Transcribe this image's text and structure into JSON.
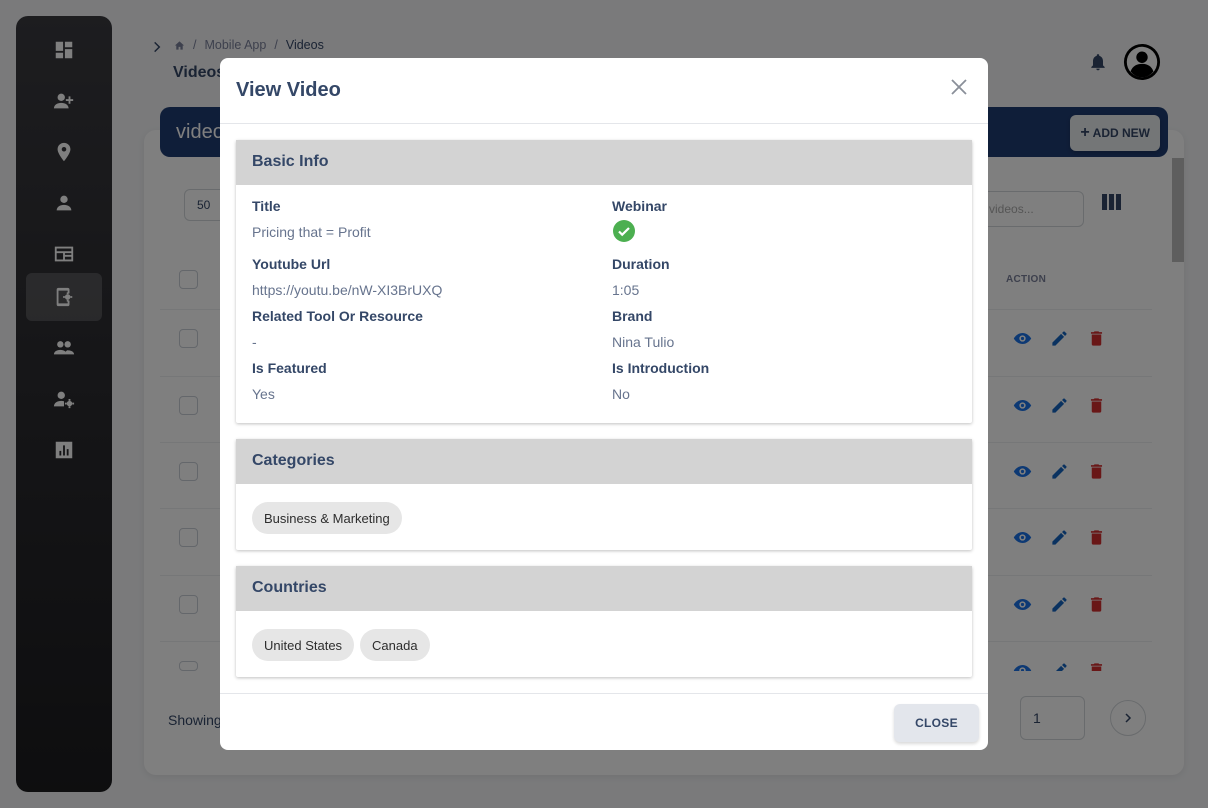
{
  "breadcrumb": {
    "parent": "Mobile App",
    "current": "Videos",
    "separator": "/"
  },
  "page": {
    "title": "Videos",
    "card_title": "videos",
    "add_new_label": "ADD NEW"
  },
  "table": {
    "per_page": "50",
    "search_placeholder": "videos...",
    "action_header": "ACTION",
    "showing_label": "Showing",
    "page_number": "1"
  },
  "sidebar": {
    "items": [
      {
        "icon": "dashboard-icon"
      },
      {
        "icon": "add-user-icon"
      },
      {
        "icon": "location-pin-icon"
      },
      {
        "icon": "person-icon"
      },
      {
        "icon": "news-icon"
      },
      {
        "icon": "mobile-settings-icon",
        "active": true
      },
      {
        "icon": "group-icon"
      },
      {
        "icon": "user-settings-icon"
      },
      {
        "icon": "analytics-icon"
      }
    ]
  },
  "modal": {
    "title": "View Video",
    "close_label": "CLOSE",
    "basic_info": {
      "heading": "Basic Info",
      "title_label": "Title",
      "title_value": "Pricing that = Profit",
      "webinar_label": "Webinar",
      "webinar_value": true,
      "youtube_label": "Youtube Url",
      "youtube_value": "https://youtu.be/nW-XI3BrUXQ",
      "duration_label": "Duration",
      "duration_value": "1:05",
      "related_label": "Related Tool Or Resource",
      "related_value": "-",
      "brand_label": "Brand",
      "brand_value": "Nina Tulio",
      "featured_label": "Is Featured",
      "featured_value": "Yes",
      "intro_label": "Is Introduction",
      "intro_value": "No"
    },
    "categories": {
      "heading": "Categories",
      "items": [
        "Business & Marketing"
      ]
    },
    "countries": {
      "heading": "Countries",
      "items": [
        "United States",
        "Canada"
      ]
    }
  },
  "colors": {
    "header_navy": "#1f3c72",
    "view_icon": "#1a73e8",
    "edit_icon": "#1565c0",
    "delete_icon": "#d32f2f",
    "success_green": "#4caf50"
  }
}
